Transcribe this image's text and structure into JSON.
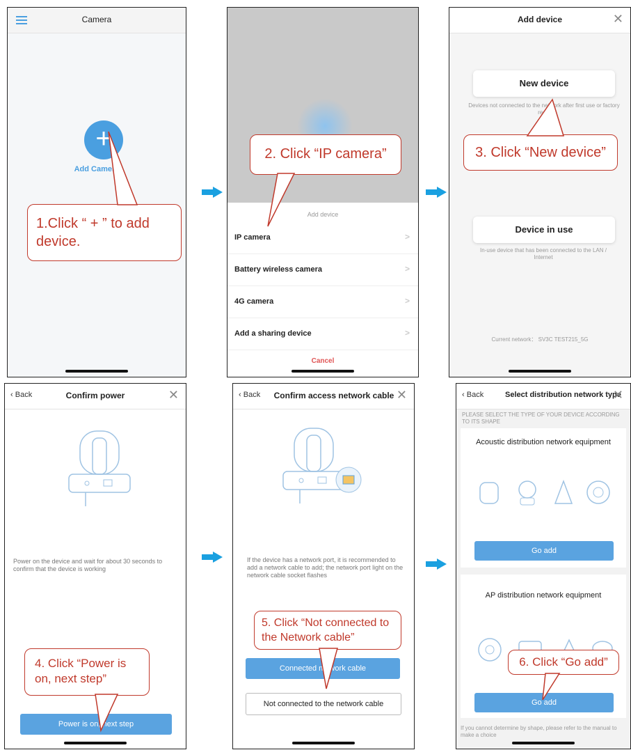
{
  "arrow_color": "#1aa0e0",
  "accent_blue": "#4a9fe0",
  "callout_red": "#c0392b",
  "panel1": {
    "title": "Camera",
    "add_label": "Add Camera",
    "callout": "1.Click “ + ” to add device."
  },
  "panel2": {
    "sheet_title": "Add device",
    "items": [
      "IP camera",
      "Battery wireless camera",
      "4G camera",
      "Add a sharing device"
    ],
    "cancel": "Cancel",
    "callout": "2. Click “IP camera”"
  },
  "panel3": {
    "title": "Add device",
    "new_device": "New device",
    "new_device_desc": "Devices not connected to the network after first use or factory reset",
    "device_in_use": "Device in use",
    "device_in_use_desc": "In-use device that has been connected to the LAN / Internet",
    "current_network": "Current network： SV3C TEST215_5G",
    "callout": "3. Click “New device”"
  },
  "panel4": {
    "back": "Back",
    "title": "Confirm power",
    "description": "Power on the device and wait for about 30 seconds to confirm that the device is working",
    "button": "Power is on, next step",
    "callout": "4. Click “Power is on, next step”"
  },
  "panel5": {
    "back": "Back",
    "title": "Confirm access network cable",
    "description": "If the device has a network port, it is recommended to add a network cable to add; the network port light on the network cable socket flashes",
    "connected_button": "Connected network cable",
    "not_connected_button": "Not connected to the network cable",
    "callout": "5. Click “Not connected to the Network cable”"
  },
  "panel6": {
    "back": "Back",
    "title": "Select distribution network type",
    "hint": "PLEASE SELECT THE TYPE OF YOUR DEVICE ACCORDING TO ITS SHAPE",
    "section1": "Acoustic distribution network equipment",
    "go_add_1": "Go add",
    "section2": "AP distribution network equipment",
    "go_add_2": "Go add",
    "footer": "If you cannot determine by shape, please refer to the manual to make a choice",
    "callout": "6. Click “Go add”"
  }
}
